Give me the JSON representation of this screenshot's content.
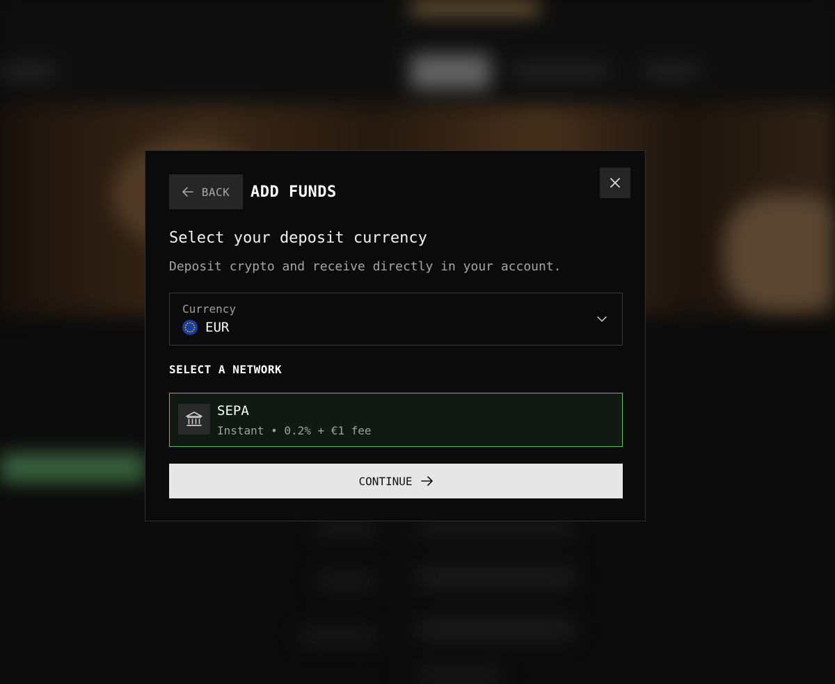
{
  "modal": {
    "back_label": "BACK",
    "title": "ADD FUNDS",
    "heading": "Select your deposit currency",
    "subheading": "Deposit crypto and receive directly in your account.",
    "currency": {
      "label": "Currency",
      "value": "EUR",
      "flag_icon": "eu-flag-icon"
    },
    "network_section_title": "SELECT A NETWORK",
    "networks": [
      {
        "name": "SEPA",
        "description": "Instant • 0.2% + €1 fee",
        "icon": "bank-icon",
        "selected": true
      }
    ],
    "continue_label": "CONTINUE"
  },
  "colors": {
    "modal_bg": "#0b0b0b",
    "accent_green": "#5fbf6e",
    "selected_card_bg": "#101a12",
    "button_light": "#e6e6e6"
  }
}
